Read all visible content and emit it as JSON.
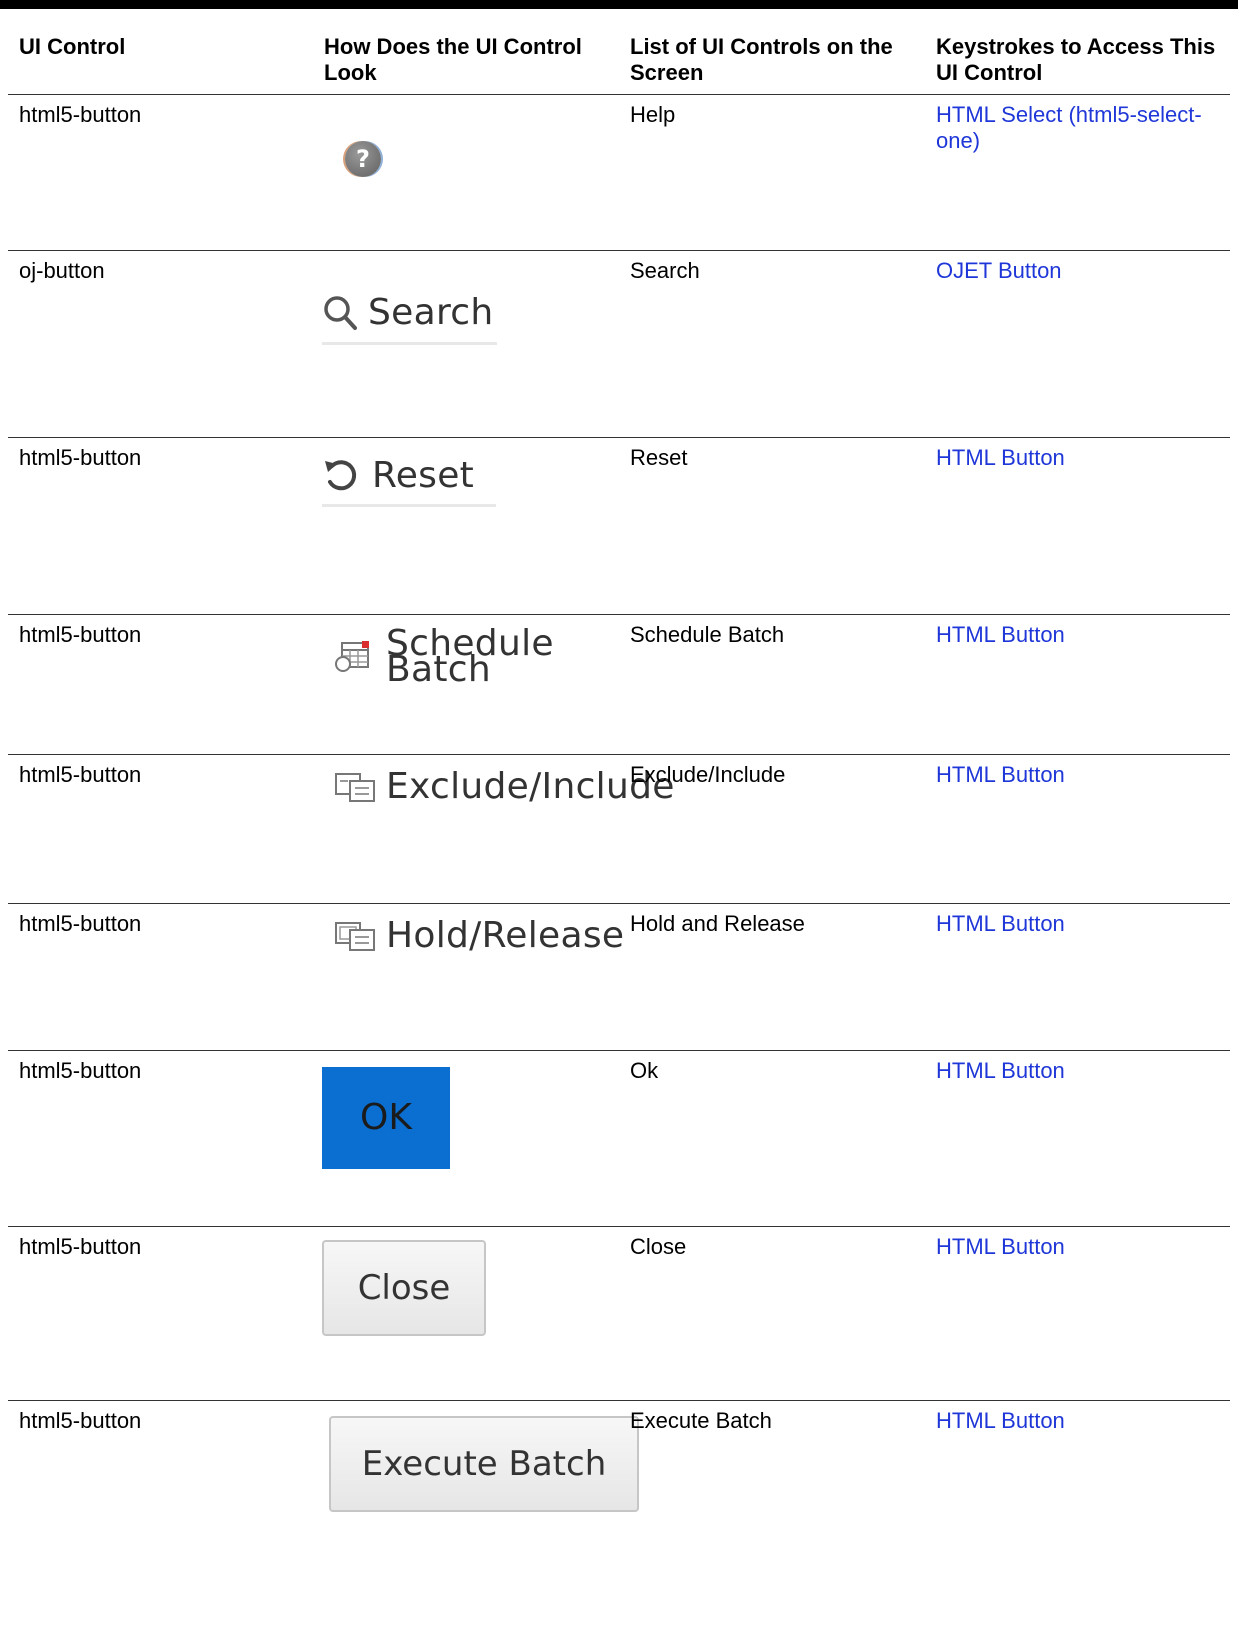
{
  "table": {
    "headers": [
      "UI Control",
      "How Does the UI Control Look",
      "List of UI Controls on the Screen",
      "Keystrokes to Access This UI Control"
    ],
    "rows": [
      {
        "control": "html5-button",
        "look": "",
        "name": "Help",
        "keystrokes": "HTML Select (html5-select-one)",
        "icon": "help-icon"
      },
      {
        "control": "oj-button",
        "look": "Search",
        "name": "Search",
        "keystrokes": "OJET Button",
        "icon": "search-icon"
      },
      {
        "control": "html5-button",
        "look": "Reset",
        "name": "Reset",
        "keystrokes": "HTML Button",
        "icon": "reset-icon"
      },
      {
        "control": "html5-button",
        "look": "Schedule Batch",
        "name": "Schedule Batch",
        "keystrokes": "HTML Button",
        "icon": "schedule-batch-icon"
      },
      {
        "control": "html5-button",
        "look": "Exclude/Include",
        "name": "Exclude/Include",
        "keystrokes": "HTML Button",
        "icon": "exclude-include-icon"
      },
      {
        "control": "html5-button",
        "look": "Hold/Release",
        "name": "Hold and Release",
        "keystrokes": "HTML Button",
        "icon": "hold-release-icon"
      },
      {
        "control": "html5-button",
        "look": "OK",
        "name": "Ok",
        "keystrokes": "HTML Button",
        "icon": ""
      },
      {
        "control": "html5-button",
        "look": "Close",
        "name": "Close",
        "keystrokes": "HTML Button",
        "icon": ""
      },
      {
        "control": "html5-button",
        "look": "Execute Batch",
        "name": "Execute Batch",
        "keystrokes": "HTML Button",
        "icon": ""
      }
    ]
  },
  "colors": {
    "link": "#1f37d8",
    "ok_button": "#0a6fd1",
    "rule": "#000000"
  }
}
